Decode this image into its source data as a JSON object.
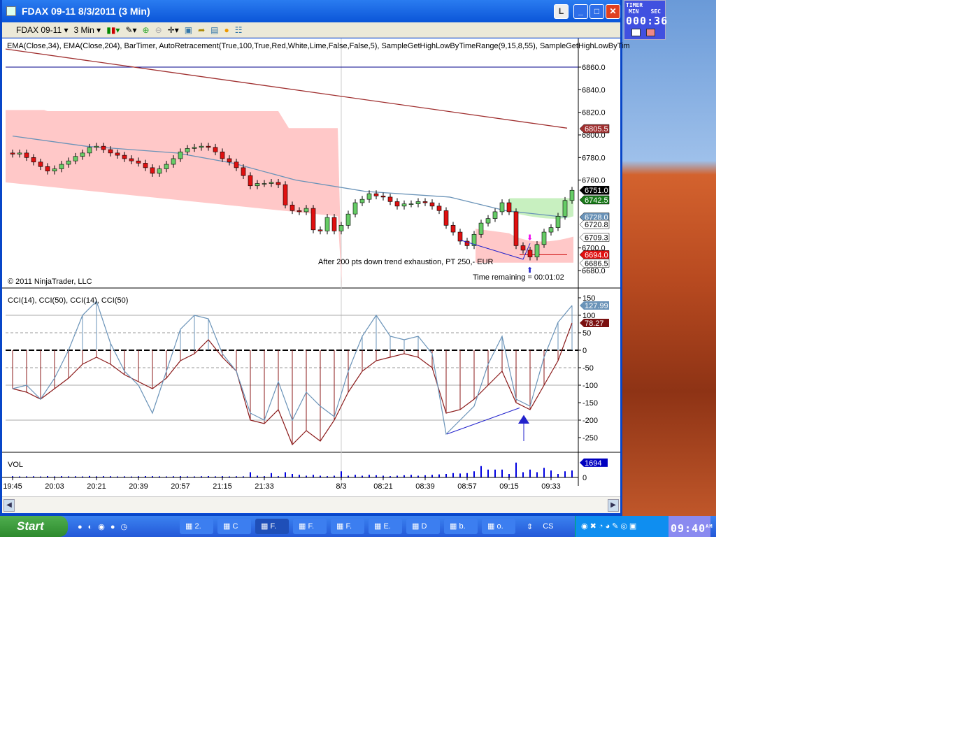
{
  "window": {
    "title": "FDAX 09-11  8/3/2011 (3 Min)",
    "btn_l": "L"
  },
  "toolbar": {
    "instrument": "FDAX 09-11",
    "interval": "3 Min"
  },
  "indicators": "EMA(Close,34),  EMA(Close,204),  BarTimer,  AutoRetracement(True,100,True,Red,White,Lime,False,False,5),  SampleGetHighLowByTimeRange(9,15,8,55),  SampleGetHighLowByTim",
  "copyright": "© 2011 NinjaTrader, LLC",
  "annotation": "After 200 pts down trend exhaustion, PT 250,- EUR",
  "time_remaining": "Time remaining = 00:01:02",
  "cci_title": "CCI(14), CCI(50), CCI(14), CCI(50)",
  "vol_title": "VOL",
  "timer": {
    "label": "TIMER",
    "min": "MIN",
    "sec": "SEC",
    "value": "000:36"
  },
  "taskbar": {
    "start": "Start",
    "items": [
      "2.",
      "C",
      "F.",
      "F.",
      "F.",
      "E.",
      "D",
      "b.",
      "o."
    ],
    "lang": "CS",
    "clock": "09:40",
    "ampm": "AM"
  },
  "colors": {
    "up": "#66cc66",
    "down": "#e01010",
    "ema34": "#6a93b8",
    "ema204": "#a03030",
    "zone_red": "#ffc8c8",
    "zone_green": "#c8f0c0"
  },
  "chart_data": {
    "type": "candlestick",
    "price_ticks": [
      "6860.0",
      "6840.0",
      "6820.0",
      "6800.0",
      "6780.0",
      "6760.0",
      "6700.0",
      "6680.0"
    ],
    "price_labels": [
      {
        "v": 6805.5,
        "t": "6805.5",
        "c": "#a03030"
      },
      {
        "v": 6751.0,
        "t": "6751.0",
        "c": "#000000"
      },
      {
        "v": 6742.5,
        "t": "6742.5",
        "c": "#1a7a1a"
      },
      {
        "v": 6727.3,
        "t": "6728.0",
        "c": "#6a93b8"
      },
      {
        "v": 6720.8,
        "t": "6720.8",
        "c": "#ffffff"
      },
      {
        "v": 6709.3,
        "t": "6709.3",
        "c": "#ffffff"
      },
      {
        "v": 6694.0,
        "t": "6694.0",
        "c": "#e01010"
      },
      {
        "v": 6686.5,
        "t": "6686.5",
        "c": "#ffffff"
      }
    ],
    "closes": [
      6783,
      6784,
      6780,
      6776,
      6772,
      6768,
      6770,
      6774,
      6777,
      6781,
      6784,
      6789,
      6790,
      6787,
      6784,
      6782,
      6779,
      6777,
      6775,
      6771,
      6766,
      6770,
      6774,
      6779,
      6785,
      6788,
      6789,
      6790,
      6789,
      6785,
      6779,
      6776,
      6771,
      6764,
      6755,
      6757,
      6757,
      6758,
      6756,
      6738,
      6733,
      6732,
      6735,
      6716,
      6715,
      6727,
      6715,
      6720,
      6730,
      6740,
      6743,
      6748,
      6746,
      6745,
      6741,
      6737,
      6739,
      6739,
      6741,
      6740,
      6737,
      6733,
      6720,
      6714,
      6706,
      6702,
      6712,
      6722,
      6726,
      6732,
      6740,
      6732,
      6702,
      6698,
      6692,
      6703,
      6714,
      6718,
      6728,
      6742,
      6751
    ],
    "time_labels": [
      {
        "bar": 0,
        "t": "19:45"
      },
      {
        "bar": 6,
        "t": "20:03"
      },
      {
        "bar": 12,
        "t": "20:21"
      },
      {
        "bar": 18,
        "t": "20:39"
      },
      {
        "bar": 24,
        "t": "20:57"
      },
      {
        "bar": 30,
        "t": "21:15"
      },
      {
        "bar": 36,
        "t": "21:33"
      },
      {
        "bar": 47,
        "t": "8/3"
      },
      {
        "bar": 53,
        "t": "08:21"
      },
      {
        "bar": 59,
        "t": "08:39"
      },
      {
        "bar": 65,
        "t": "08:57"
      },
      {
        "bar": 71,
        "t": "09:15"
      },
      {
        "bar": 77,
        "t": "09:33"
      }
    ],
    "cci_ticks": [
      150,
      100,
      50,
      0,
      -50,
      -100,
      -150,
      -200,
      -250
    ],
    "cci14": [
      -110,
      -100,
      -140,
      -80,
      0,
      100,
      140,
      20,
      -60,
      -100,
      -180,
      -60,
      60,
      100,
      90,
      -10,
      -60,
      -180,
      -200,
      -90,
      -200,
      -120,
      -160,
      -190,
      -60,
      40,
      100,
      40,
      30,
      40,
      -10,
      -240,
      -200,
      -160,
      -40,
      40,
      -140,
      -160,
      -20,
      80,
      128
    ],
    "cci50": [
      -110,
      -120,
      -140,
      -110,
      -80,
      -40,
      -20,
      -40,
      -70,
      -90,
      -110,
      -80,
      -30,
      -10,
      30,
      -20,
      -60,
      -200,
      -210,
      -170,
      -270,
      -230,
      -260,
      -200,
      -120,
      -60,
      -30,
      -20,
      -10,
      -20,
      -50,
      -180,
      -170,
      -140,
      -100,
      -60,
      -150,
      -170,
      -100,
      -30,
      78
    ],
    "cci14_label": "127.99",
    "cci50_label": "78.27",
    "volume": [
      150,
      120,
      130,
      140,
      110,
      160,
      120,
      150,
      130,
      140,
      120,
      170,
      130,
      150,
      140,
      120,
      130,
      110,
      140,
      160,
      150,
      130,
      120,
      140,
      150,
      130,
      120,
      140,
      160,
      130,
      150,
      120,
      140,
      130,
      600,
      200,
      150,
      500,
      150,
      600,
      400,
      300,
      200,
      300,
      200,
      150,
      200,
      700,
      200,
      300,
      200,
      300,
      250,
      200,
      150,
      200,
      250,
      300,
      200,
      250,
      300,
      350,
      400,
      500,
      450,
      500,
      700,
      1300,
      900,
      900,
      900,
      400,
      1700,
      600,
      900,
      600,
      1100,
      800,
      400,
      700,
      800
    ],
    "vol_label": "1694",
    "vol_ticks": [
      "0"
    ]
  }
}
